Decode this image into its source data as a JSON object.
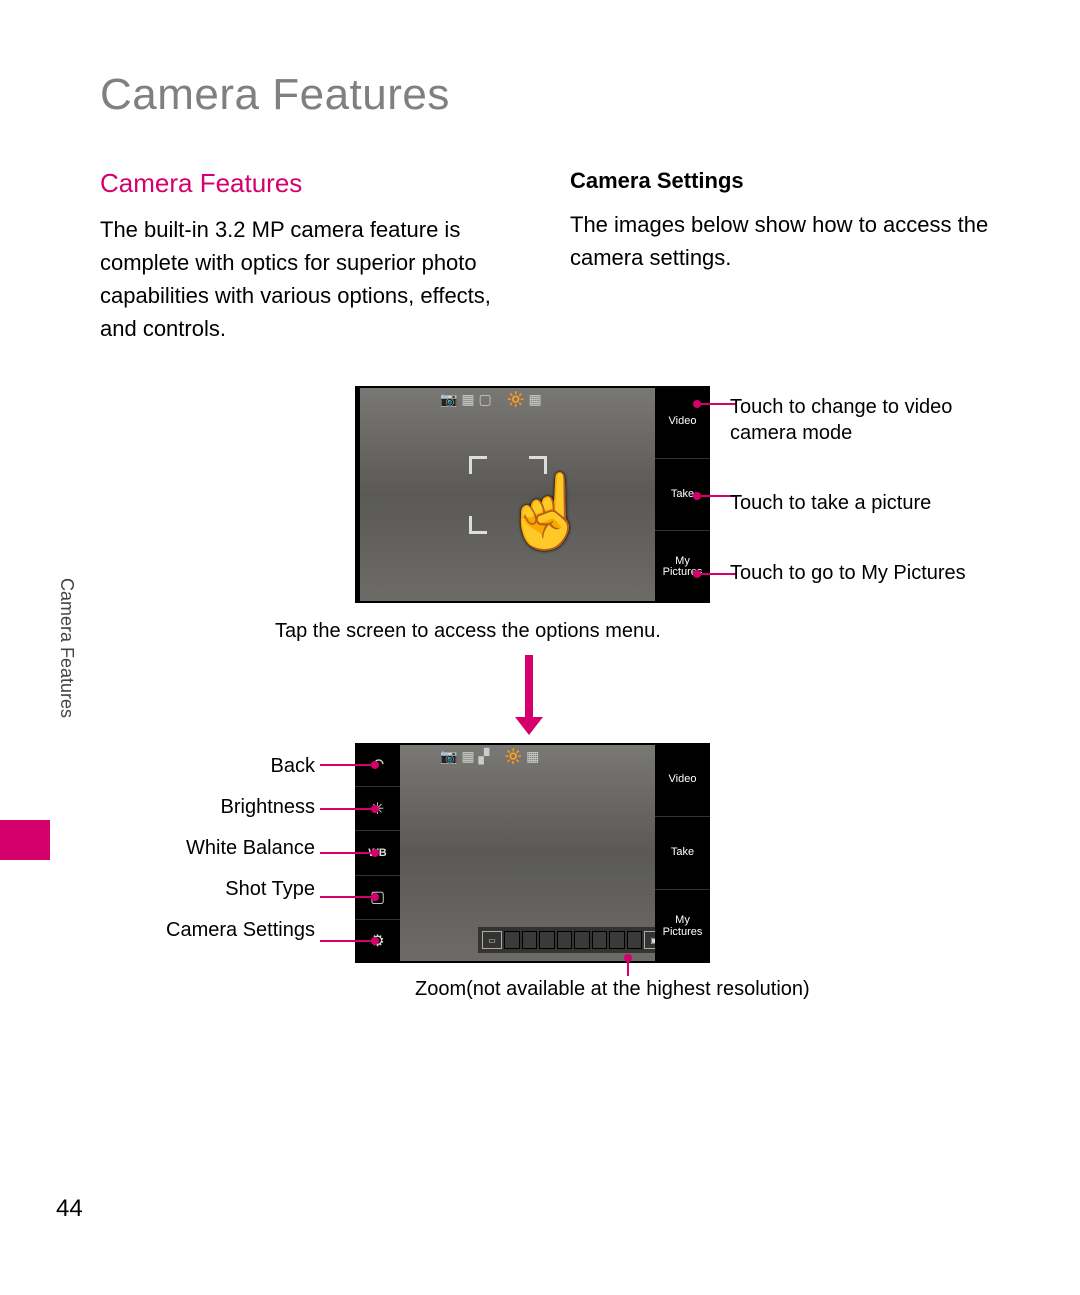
{
  "page_title": "Camera Features",
  "section_tab": "Camera Features",
  "page_number": "44",
  "left": {
    "heading": "Camera Features",
    "body": "The built-in 3.2 MP camera feature is complete with optics for superior photo capabilities with various options, effects, and controls."
  },
  "right": {
    "heading": "Camera Settings",
    "body": "The images below show how to access the camera settings."
  },
  "fig1": {
    "buttons": {
      "video": "Video",
      "take": "Take",
      "mypics": "My\nPictures"
    },
    "callouts": {
      "video": "Touch to change to video camera mode",
      "take": "Touch to take a picture",
      "mypics": "Touch to go to My Pictures"
    },
    "caption": "Tap the screen to access the options menu."
  },
  "fig2": {
    "left_labels": {
      "back": "Back",
      "brightness": "Brightness",
      "wb": "White Balance",
      "shot": "Shot Type",
      "settings": "Camera Settings"
    },
    "buttons": {
      "video": "Video",
      "take": "Take",
      "mypics": "My\nPictures"
    },
    "zoom_note": "Zoom(not available at the highest resolution)"
  }
}
